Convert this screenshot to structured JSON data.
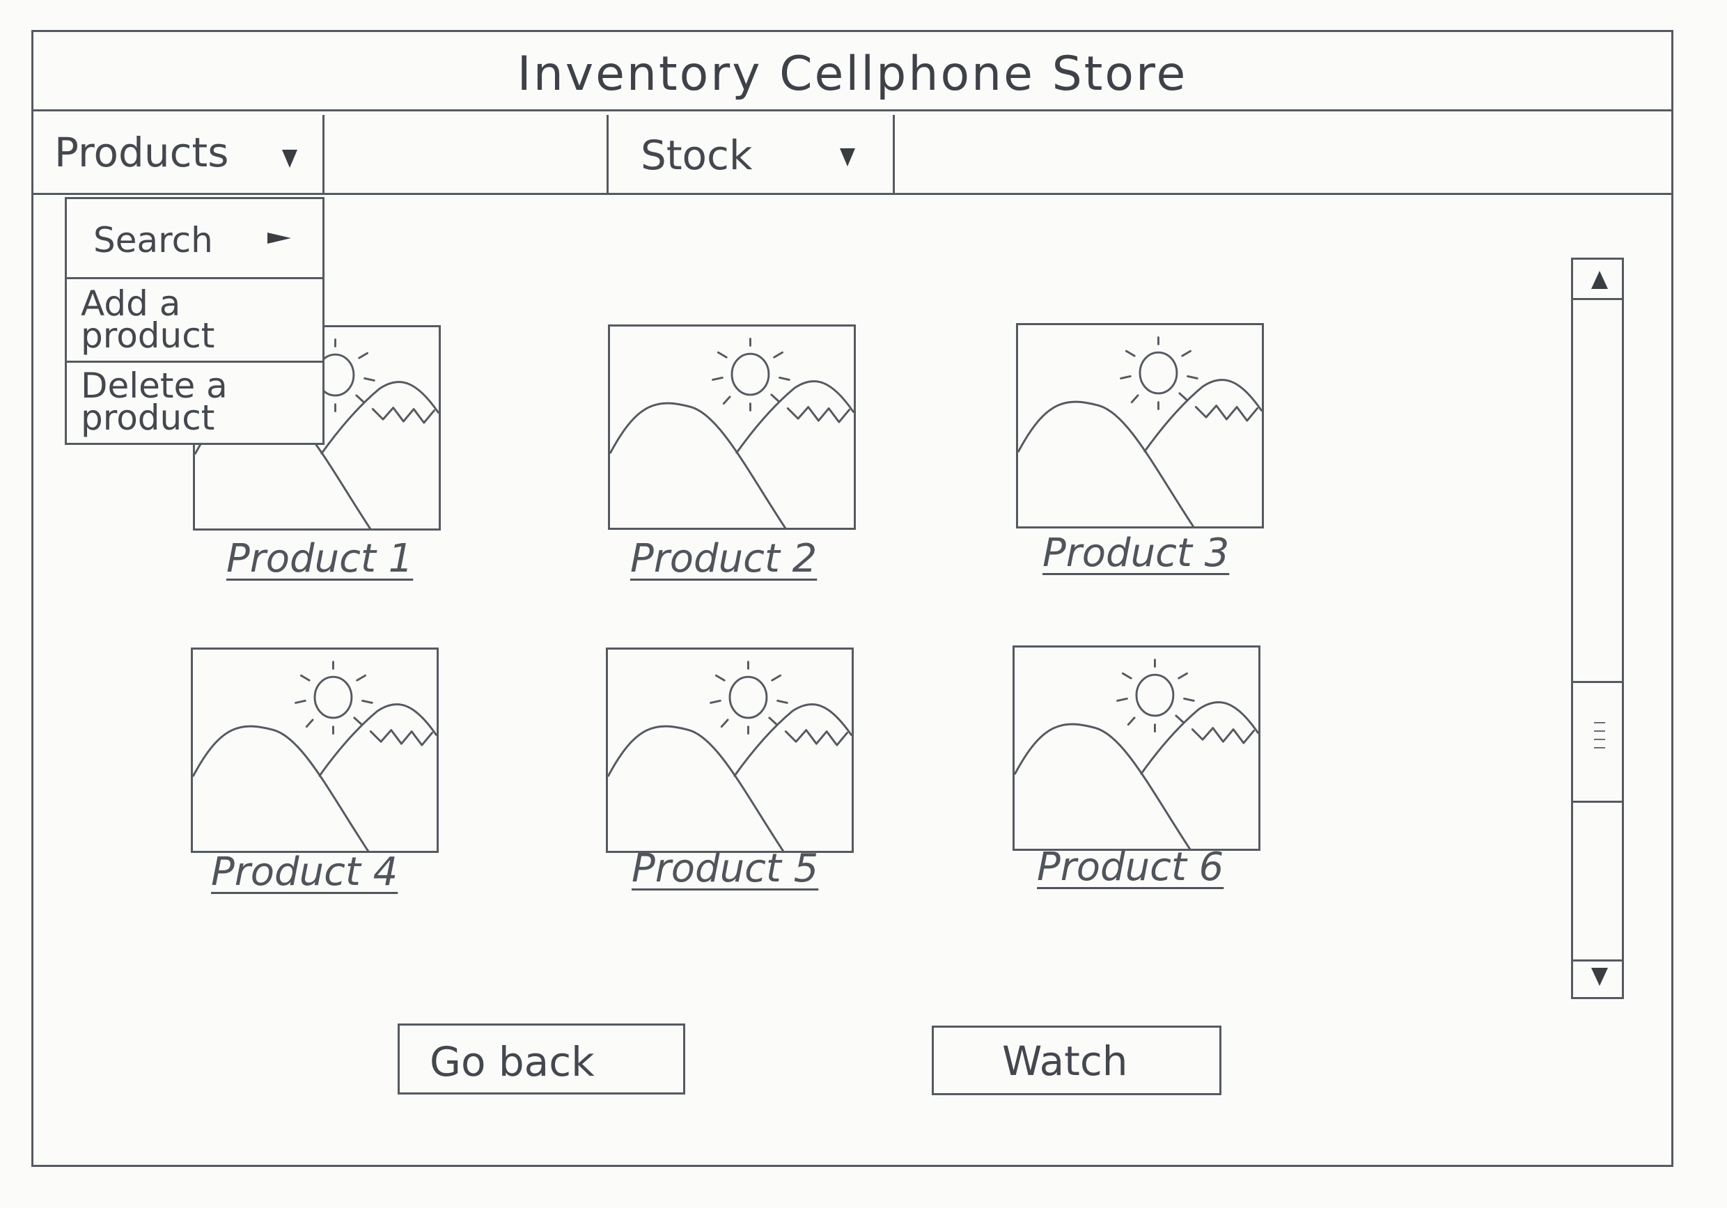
{
  "window": {
    "title": "Inventory Cellphone Store"
  },
  "menubar": {
    "products": {
      "label": "Products",
      "icon": "triangle-down-icon"
    },
    "stock": {
      "label": "Stock",
      "icon": "triangle-down-icon"
    }
  },
  "products_menu": {
    "items": [
      {
        "label": "Search",
        "icon": "triangle-right-icon"
      },
      {
        "label": "Add a product"
      },
      {
        "label": "Delete a product"
      }
    ]
  },
  "products": [
    {
      "label": "Product 1",
      "image": "image-placeholder-icon"
    },
    {
      "label": "Product 2",
      "image": "image-placeholder-icon"
    },
    {
      "label": "Product 3",
      "image": "image-placeholder-icon"
    },
    {
      "label": "Product 4",
      "image": "image-placeholder-icon"
    },
    {
      "label": "Product 5",
      "image": "image-placeholder-icon"
    },
    {
      "label": "Product 6",
      "image": "image-placeholder-icon"
    }
  ],
  "scrollbar": {
    "up_icon": "scroll-up-icon",
    "down_icon": "scroll-down-icon",
    "thumb_icon": "grip-icon"
  },
  "buttons": {
    "go_back": "Go back",
    "watch": "Watch"
  }
}
